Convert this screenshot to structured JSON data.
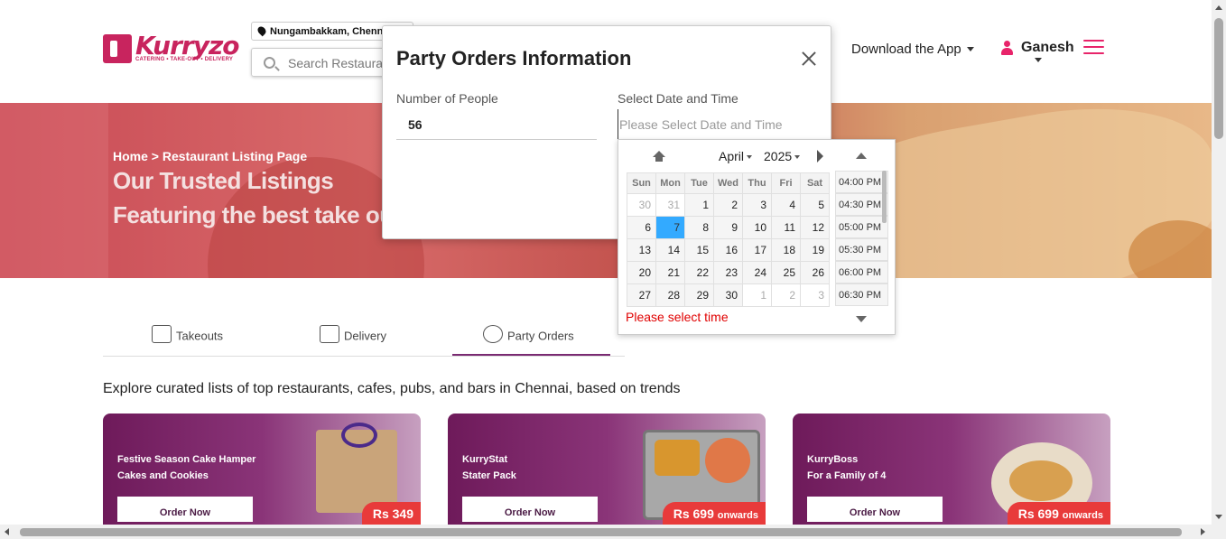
{
  "header": {
    "logo": {
      "name": "Kurryzo",
      "tagline": "CATERING • TAKE-OUT • DELIVERY"
    },
    "location": "Nungambakkam, Chennai",
    "search_placeholder": "Search Restaurants",
    "download_app": "Download the App",
    "user_name": "Ganesh"
  },
  "banner": {
    "breadcrumb": "Home > Restaurant Listing Page",
    "title": "Our Trusted Listings",
    "subtitle": "Featuring the best take out"
  },
  "tabs": [
    {
      "label": "Takeouts",
      "icon": "takeout-icon"
    },
    {
      "label": "Delivery",
      "icon": "delivery-icon"
    },
    {
      "label": "Party Orders",
      "icon": "party-icon",
      "active": true
    }
  ],
  "explore_text": "Explore curated lists of top restaurants, cafes, pubs, and bars in Chennai, based on trends",
  "cards": [
    {
      "line1": "Festive Season Cake Hamper",
      "line2": "Cakes and Cookies",
      "button": "Order Now",
      "price": "Rs 349",
      "suffix": ""
    },
    {
      "line1": "KurryStat",
      "line2": "Stater Pack",
      "button": "Order Now",
      "price": "Rs 699",
      "suffix": "onwards"
    },
    {
      "line1": "KurryBoss",
      "line2": "For a Family of 4",
      "button": "Order Now",
      "price": "Rs 699",
      "suffix": "onwards"
    }
  ],
  "modal": {
    "title": "Party Orders Information",
    "people_label": "Number of People",
    "people_value": "56",
    "date_label": "Select Date and Time",
    "date_placeholder": "Please Select Date and Time"
  },
  "datepicker": {
    "month": "April",
    "year": "2025",
    "weekdays": [
      "Sun",
      "Mon",
      "Tue",
      "Wed",
      "Thu",
      "Fri",
      "Sat"
    ],
    "weeks": [
      [
        {
          "d": "30",
          "o": true
        },
        {
          "d": "31",
          "o": true
        },
        {
          "d": "1"
        },
        {
          "d": "2"
        },
        {
          "d": "3"
        },
        {
          "d": "4"
        },
        {
          "d": "5"
        }
      ],
      [
        {
          "d": "6"
        },
        {
          "d": "7",
          "s": true
        },
        {
          "d": "8"
        },
        {
          "d": "9"
        },
        {
          "d": "10"
        },
        {
          "d": "11"
        },
        {
          "d": "12"
        }
      ],
      [
        {
          "d": "13"
        },
        {
          "d": "14"
        },
        {
          "d": "15"
        },
        {
          "d": "16"
        },
        {
          "d": "17"
        },
        {
          "d": "18"
        },
        {
          "d": "19"
        }
      ],
      [
        {
          "d": "20"
        },
        {
          "d": "21"
        },
        {
          "d": "22"
        },
        {
          "d": "23"
        },
        {
          "d": "24"
        },
        {
          "d": "25"
        },
        {
          "d": "26"
        }
      ],
      [
        {
          "d": "27"
        },
        {
          "d": "28"
        },
        {
          "d": "29"
        },
        {
          "d": "30"
        },
        {
          "d": "1",
          "o": true
        },
        {
          "d": "2",
          "o": true
        },
        {
          "d": "3",
          "o": true
        }
      ]
    ],
    "times": [
      "04:00 PM",
      "04:30 PM",
      "05:00 PM",
      "05:30 PM",
      "06:00 PM",
      "06:30 PM"
    ],
    "error": "Please select time"
  }
}
